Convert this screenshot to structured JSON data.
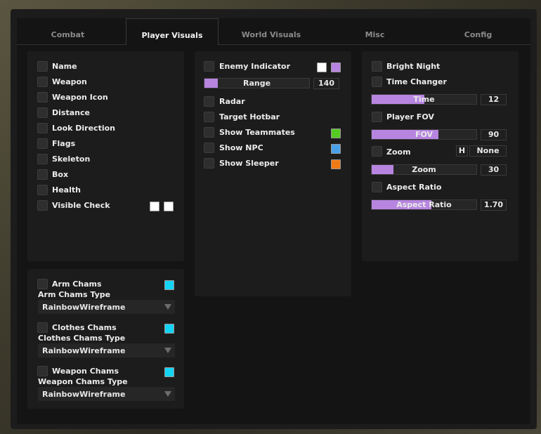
{
  "tabs": [
    "Combat",
    "Player Visuals",
    "World Visuals",
    "Misc",
    "Config"
  ],
  "left": {
    "items": [
      "Name",
      "Weapon",
      "Weapon Icon",
      "Distance",
      "Look Direction",
      "Flags",
      "Skeleton",
      "Box",
      "Health",
      "Visible Check"
    ],
    "visible_check_colors": [
      "#ffffff",
      "#ffffff"
    ]
  },
  "chams": {
    "arm_label": "Arm Chams",
    "arm_type_label": "Arm Chams Type",
    "arm_type_value": "RainbowWireframe",
    "clothes_label": "Clothes Chams",
    "clothes_type_label": "Clothes Chams Type",
    "clothes_type_value": "RainbowWireframe",
    "weapon_label": "Weapon Chams",
    "weapon_type_label": "Weapon Chams Type",
    "weapon_type_value": "RainbowWireframe",
    "color": "#14d4f4"
  },
  "middle": {
    "enemy_indicator": "Enemy Indicator",
    "enemy_colors": [
      "#ffffff",
      "#b785e0"
    ],
    "range_label": "Range",
    "range_value": "140",
    "range_fraction": 0.13,
    "radar": "Radar",
    "target_hotbar": "Target Hotbar",
    "show_teammates": "Show Teammates",
    "teammates_color": "#55cc22",
    "show_npc": "Show NPC",
    "npc_color": "#4aa0e8",
    "show_sleeper": "Show Sleeper",
    "sleeper_color": "#f07a14"
  },
  "right": {
    "bright_night": "Bright Night",
    "time_changer": "Time Changer",
    "time_label": "Time",
    "time_value": "12",
    "time_fraction": 0.5,
    "player_fov": "Player FOV",
    "fov_label": "FOV",
    "fov_value": "90",
    "fov_fraction": 0.64,
    "zoom": "Zoom",
    "zoom_key": "H",
    "zoom_mode": "None",
    "zoom_slider_label": "Zoom",
    "zoom_value": "30",
    "zoom_fraction": 0.21,
    "aspect_ratio": "Aspect Ratio",
    "aspect_label": "Aspect Ratio",
    "aspect_value": "1.70",
    "aspect_fraction": 0.57
  }
}
